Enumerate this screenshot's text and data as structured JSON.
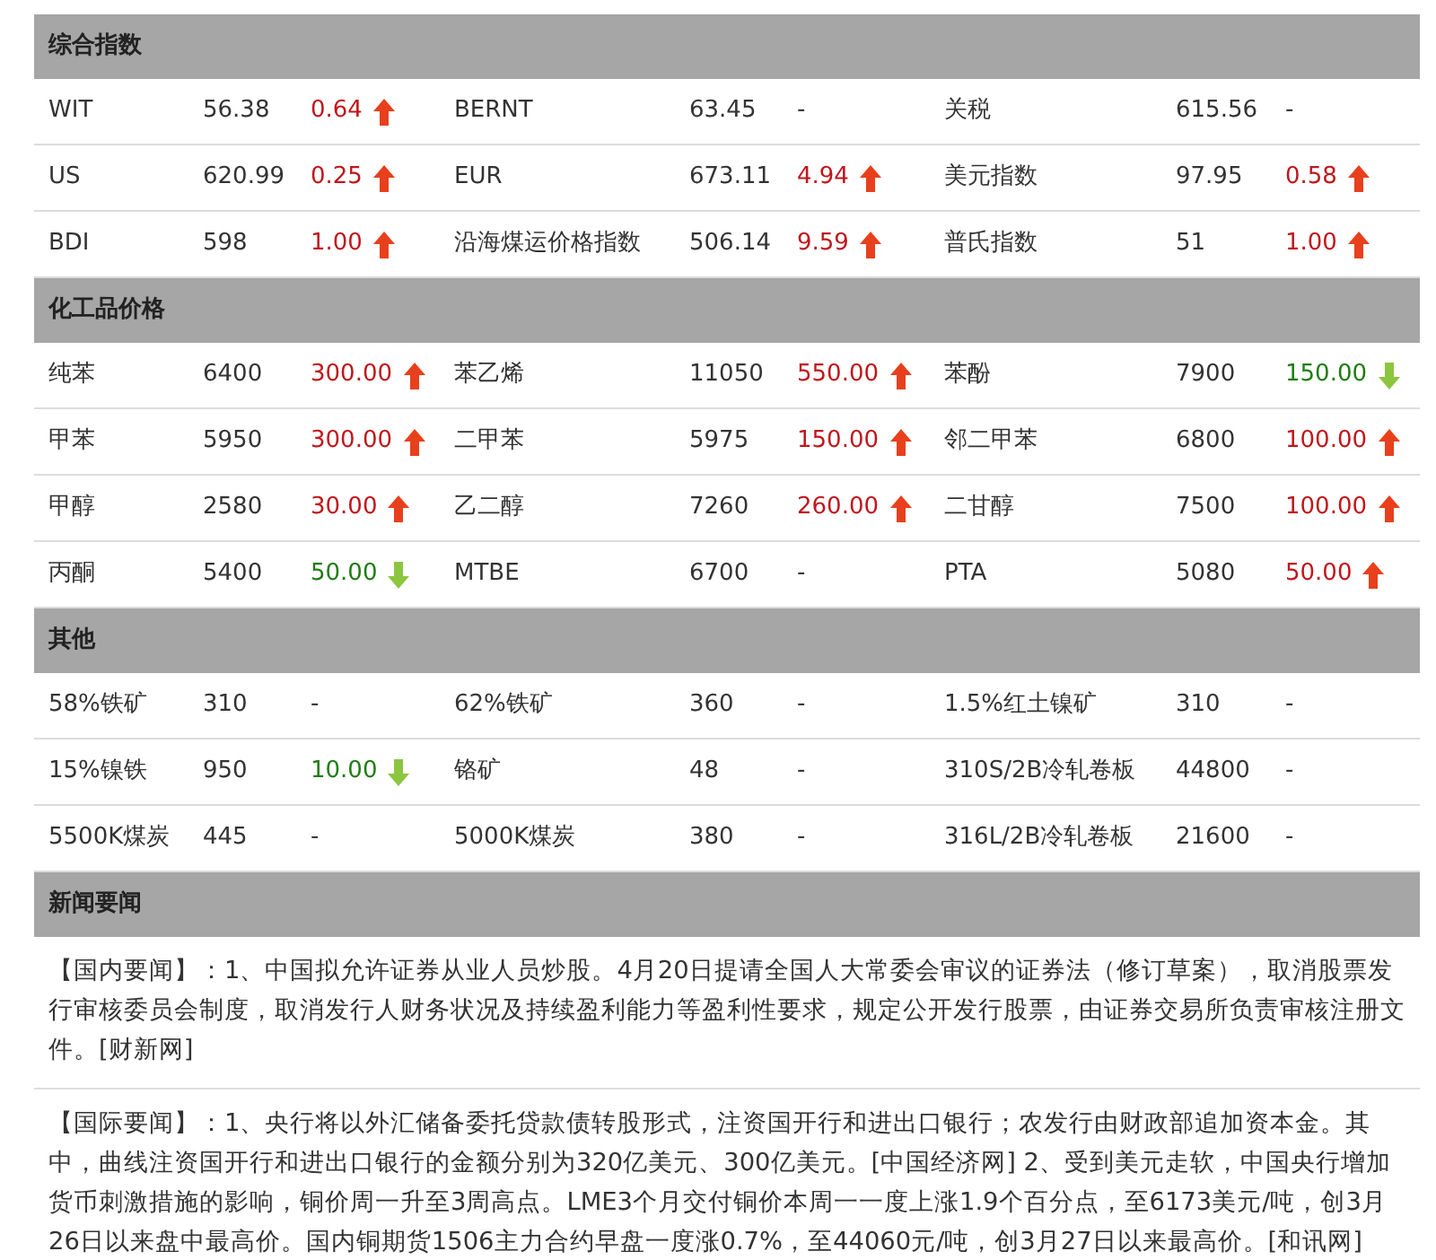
{
  "sections": [
    {
      "title": "综合指数",
      "rows": [
        [
          {
            "name": "WIT",
            "value": "56.38",
            "change": "0.64",
            "up": true
          },
          {
            "name": "BERNT",
            "value": "63.45",
            "change": "-"
          },
          {
            "name": "关税",
            "value": "615.56",
            "change": "-"
          }
        ],
        [
          {
            "name": "US",
            "value": "620.99",
            "change": "0.25",
            "up": true
          },
          {
            "name": "EUR",
            "value": "673.11",
            "change": "4.94",
            "up": true
          },
          {
            "name": "美元指数",
            "value": "97.95",
            "change": "0.58",
            "up": true
          }
        ],
        [
          {
            "name": "BDI",
            "value": "598",
            "change": "1.00",
            "up": true
          },
          {
            "name": "沿海煤运价格指数",
            "value": "506.14",
            "change": "9.59",
            "up": true
          },
          {
            "name": "普氏指数",
            "value": "51",
            "change": "1.00",
            "up": true
          }
        ]
      ]
    },
    {
      "title": "化工品价格",
      "rows": [
        [
          {
            "name": "纯苯",
            "value": "6400",
            "change": "300.00",
            "up": true
          },
          {
            "name": "苯乙烯",
            "value": "11050",
            "change": "550.00",
            "up": true
          },
          {
            "name": "苯酚",
            "value": "7900",
            "change": "150.00",
            "up": false
          }
        ],
        [
          {
            "name": "甲苯",
            "value": "5950",
            "change": "300.00",
            "up": true
          },
          {
            "name": "二甲苯",
            "value": "5975",
            "change": "150.00",
            "up": true
          },
          {
            "name": "邻二甲苯",
            "value": "6800",
            "change": "100.00",
            "up": true
          }
        ],
        [
          {
            "name": "甲醇",
            "value": "2580",
            "change": "30.00",
            "up": true
          },
          {
            "name": "乙二醇",
            "value": "7260",
            "change": "260.00",
            "up": true
          },
          {
            "name": "二甘醇",
            "value": "7500",
            "change": "100.00",
            "up": true
          }
        ],
        [
          {
            "name": "丙酮",
            "value": "5400",
            "change": "50.00",
            "up": false
          },
          {
            "name": "MTBE",
            "value": "6700",
            "change": "-"
          },
          {
            "name": "PTA",
            "value": "5080",
            "change": "50.00",
            "up": true
          }
        ]
      ]
    },
    {
      "title": "其他",
      "rows": [
        [
          {
            "name": "58%铁矿",
            "value": "310",
            "change": "-"
          },
          {
            "name": "62%铁矿",
            "value": "360",
            "change": "-"
          },
          {
            "name": "1.5%红土镍矿",
            "value": "310",
            "change": "-"
          }
        ],
        [
          {
            "name": "15%镍铁",
            "value": "950",
            "change": "10.00",
            "up": false
          },
          {
            "name": "铬矿",
            "value": "48",
            "change": "-"
          },
          {
            "name": "310S/2B冷轧卷板",
            "value": "44800",
            "change": "-"
          }
        ],
        [
          {
            "name": "5500K煤炭",
            "value": "445",
            "change": "-"
          },
          {
            "name": "5000K煤炭",
            "value": "380",
            "change": "-"
          },
          {
            "name": "316L/2B冷轧卷板",
            "value": "21600",
            "change": "-"
          }
        ]
      ]
    }
  ],
  "news": {
    "title": "新闻要闻",
    "paragraphs": [
      "【国内要闻】：1、中国拟允许证券从业人员炒股。4月20日提请全国人大常委会审议的证券法（修订草案），取消股票发行审核委员会制度，取消发行人财务状况及持续盈利能力等盈利性要求，规定公开发行股票，由证券交易所负责审核注册文件。[财新网]",
      "【国际要闻】：1、央行将以外汇储备委托贷款债转股形式，注资国开行和进出口银行；农发行由财政部追加资本金。其中，曲线注资国开行和进出口银行的金额分别为320亿美元、300亿美元。[中国经济网] 2、受到美元走软，中国央行增加货币刺激措施的影响，铜价周一升至3周高点。LME3个月交付铜价本周一一度上涨1.9个百分点，至6173美元/吨，创3月26日以来盘中最高价。国内铜期货1506主力合约早盘一度涨0.7%，至44060元/吨，创3月27日以来最高价。[和讯网]"
    ]
  }
}
